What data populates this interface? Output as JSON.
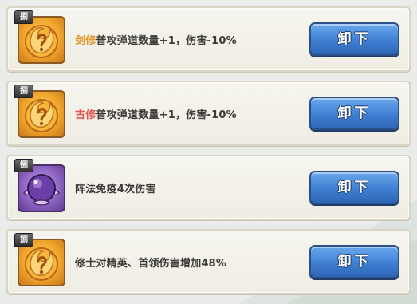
{
  "items": [
    {
      "tag": "捌",
      "icon": "flame-orb-icon",
      "icon_color": "orange",
      "prefix": "剑修",
      "prefix_color": "orange",
      "text": "普攻弹道数量+1，伤害-10%",
      "button": "卸下"
    },
    {
      "tag": "捌",
      "icon": "flame-orb-icon",
      "icon_color": "orange",
      "prefix": "古修",
      "prefix_color": "red",
      "text": "普攻弹道数量+1，伤害-10%",
      "button": "卸下"
    },
    {
      "tag": "捌",
      "icon": "purple-orb-icon",
      "icon_color": "purple",
      "prefix": "",
      "prefix_color": "",
      "text": "阵法免疫4次伤害",
      "button": "卸下"
    },
    {
      "tag": "捌",
      "icon": "flame-orb-icon",
      "icon_color": "orange",
      "prefix": "",
      "prefix_color": "",
      "text": "修士对精英、首领伤害增加48%",
      "button": "卸下"
    }
  ],
  "colors": {
    "orange_prefix": "#e0952a",
    "red_prefix": "#e0524b",
    "button_blue": "#3f7fd2",
    "card_bg": "#f3f1e8"
  }
}
